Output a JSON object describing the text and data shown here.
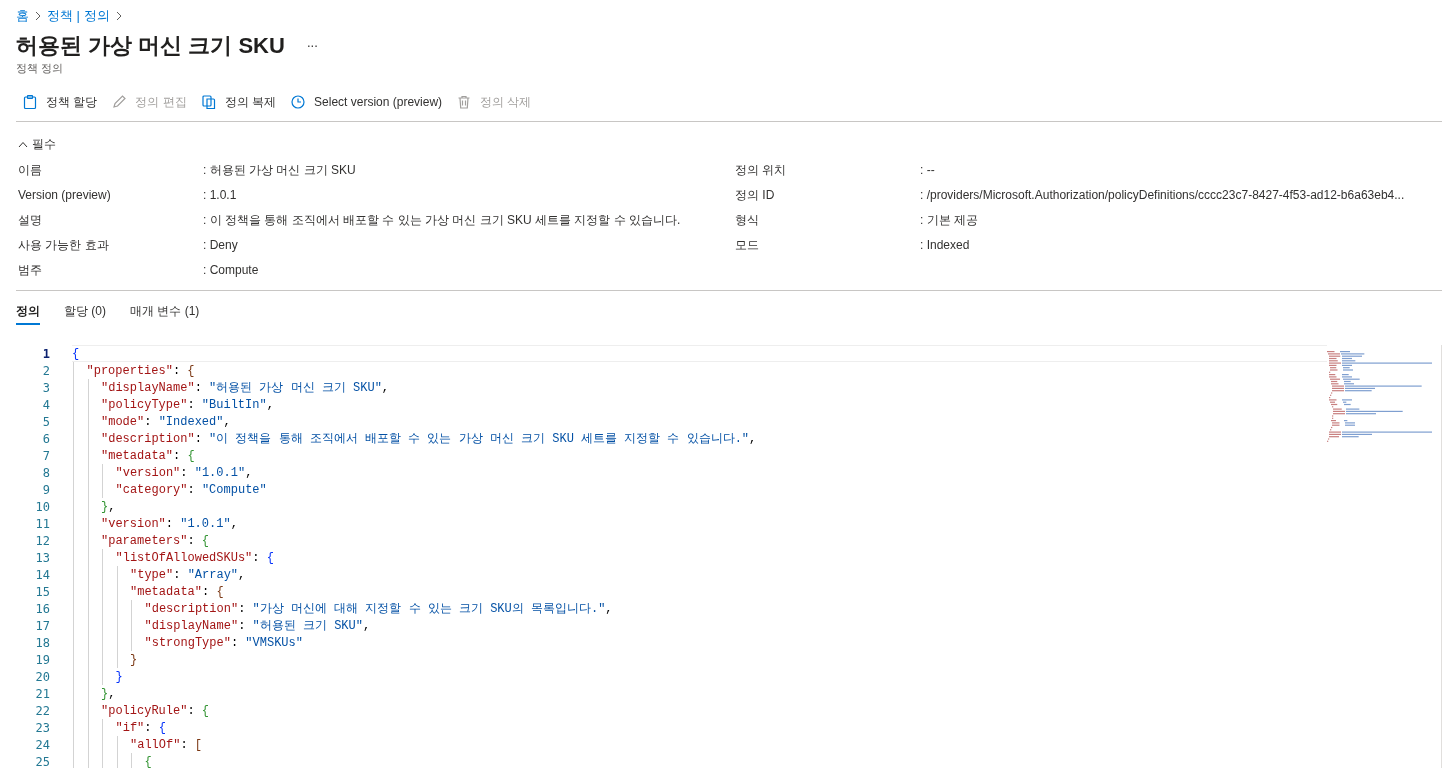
{
  "breadcrumb": [
    {
      "label": "홈"
    },
    {
      "label": "정책 | 정의"
    }
  ],
  "title": "허용된 가상 머신 크기 SKU",
  "more": "...",
  "subtitle": "정책 정의",
  "toolbar": [
    {
      "label": "정책 할당",
      "disabled": false
    },
    {
      "label": "정의 편집",
      "disabled": true
    },
    {
      "label": "정의 복제",
      "disabled": false
    },
    {
      "label": "Select version (preview)",
      "disabled": false
    },
    {
      "label": "정의 삭제",
      "disabled": true
    }
  ],
  "section": {
    "label": "필수",
    "expanded": true
  },
  "details_left": [
    {
      "label": "이름",
      "value": ": 허용된 가상 머신 크기 SKU"
    },
    {
      "label": "Version (preview)",
      "value": ": 1.0.1"
    },
    {
      "label": "설명",
      "value": ": 이 정책을 통해 조직에서 배포할 수 있는 가상 머신 크기 SKU 세트를 지정할 수 있습니다."
    },
    {
      "label": "사용 가능한 효과",
      "value": ": Deny"
    },
    {
      "label": "범주",
      "value": ": Compute"
    }
  ],
  "details_right": [
    {
      "label": "정의 위치",
      "value": ": --"
    },
    {
      "label": "정의 ID",
      "value": ": /providers/Microsoft.Authorization/policyDefinitions/cccc23c7-8427-4f53-ad12-b6a63eb4..."
    },
    {
      "label": "형식",
      "value": ": 기본 제공"
    },
    {
      "label": "모드",
      "value": ": Indexed"
    }
  ],
  "tabs": [
    {
      "label": "정의",
      "selected": true
    },
    {
      "label": "할당 (0)",
      "selected": false
    },
    {
      "label": "매개 변수 (1)",
      "selected": false
    }
  ],
  "code": [
    {
      "number": "1",
      "current": true,
      "tokens": [
        {
          "kind": "open",
          "text": "{"
        }
      ]
    },
    {
      "number": "2",
      "current": false,
      "tokens": [
        {
          "kind": "key",
          "text": "\"properties\""
        },
        {
          "kind": "punct",
          "text": ": "
        },
        {
          "kind": "open",
          "text": "{"
        }
      ]
    },
    {
      "number": "3",
      "current": false,
      "tokens": [
        {
          "kind": "key",
          "text": "\"displayName\""
        },
        {
          "kind": "punct",
          "text": ": "
        },
        {
          "kind": "string",
          "text": "\"허용된 가상 머신 크기 SKU\""
        },
        {
          "kind": "punct",
          "text": ","
        }
      ]
    },
    {
      "number": "4",
      "current": false,
      "tokens": [
        {
          "kind": "key",
          "text": "\"policyType\""
        },
        {
          "kind": "punct",
          "text": ": "
        },
        {
          "kind": "string",
          "text": "\"BuiltIn\""
        },
        {
          "kind": "punct",
          "text": ","
        }
      ]
    },
    {
      "number": "5",
      "current": false,
      "tokens": [
        {
          "kind": "key",
          "text": "\"mode\""
        },
        {
          "kind": "punct",
          "text": ": "
        },
        {
          "kind": "string",
          "text": "\"Indexed\""
        },
        {
          "kind": "punct",
          "text": ","
        }
      ]
    },
    {
      "number": "6",
      "current": false,
      "tokens": [
        {
          "kind": "key",
          "text": "\"description\""
        },
        {
          "kind": "punct",
          "text": ": "
        },
        {
          "kind": "string",
          "text": "\"이 정책을 통해 조직에서 배포할 수 있는 가상 머신 크기 SKU 세트를 지정할 수 있습니다.\""
        },
        {
          "kind": "punct",
          "text": ","
        }
      ]
    },
    {
      "number": "7",
      "current": false,
      "tokens": [
        {
          "kind": "key",
          "text": "\"metadata\""
        },
        {
          "kind": "punct",
          "text": ": "
        },
        {
          "kind": "open",
          "text": "{"
        }
      ]
    },
    {
      "number": "8",
      "current": false,
      "tokens": [
        {
          "kind": "key",
          "text": "\"version\""
        },
        {
          "kind": "punct",
          "text": ": "
        },
        {
          "kind": "string",
          "text": "\"1.0.1\""
        },
        {
          "kind": "punct",
          "text": ","
        }
      ]
    },
    {
      "number": "9",
      "current": false,
      "tokens": [
        {
          "kind": "key",
          "text": "\"category\""
        },
        {
          "kind": "punct",
          "text": ": "
        },
        {
          "kind": "string",
          "text": "\"Compute\""
        }
      ]
    },
    {
      "number": "10",
      "current": false,
      "tokens": [
        {
          "kind": "close",
          "text": "}"
        },
        {
          "kind": "punct",
          "text": ","
        }
      ]
    },
    {
      "number": "11",
      "current": false,
      "tokens": [
        {
          "kind": "key",
          "text": "\"version\""
        },
        {
          "kind": "punct",
          "text": ": "
        },
        {
          "kind": "string",
          "text": "\"1.0.1\""
        },
        {
          "kind": "punct",
          "text": ","
        }
      ]
    },
    {
      "number": "12",
      "current": false,
      "tokens": [
        {
          "kind": "key",
          "text": "\"parameters\""
        },
        {
          "kind": "punct",
          "text": ": "
        },
        {
          "kind": "open",
          "text": "{"
        }
      ]
    },
    {
      "number": "13",
      "current": false,
      "tokens": [
        {
          "kind": "key",
          "text": "\"listOfAllowedSKUs\""
        },
        {
          "kind": "punct",
          "text": ": "
        },
        {
          "kind": "open",
          "text": "{"
        }
      ]
    },
    {
      "number": "14",
      "current": false,
      "tokens": [
        {
          "kind": "key",
          "text": "\"type\""
        },
        {
          "kind": "punct",
          "text": ": "
        },
        {
          "kind": "string",
          "text": "\"Array\""
        },
        {
          "kind": "punct",
          "text": ","
        }
      ]
    },
    {
      "number": "15",
      "current": false,
      "tokens": [
        {
          "kind": "key",
          "text": "\"metadata\""
        },
        {
          "kind": "punct",
          "text": ": "
        },
        {
          "kind": "open",
          "text": "{"
        }
      ]
    },
    {
      "number": "16",
      "current": false,
      "tokens": [
        {
          "kind": "key",
          "text": "\"description\""
        },
        {
          "kind": "punct",
          "text": ": "
        },
        {
          "kind": "string",
          "text": "\"가상 머신에 대해 지정할 수 있는 크기 SKU의 목록입니다.\""
        },
        {
          "kind": "punct",
          "text": ","
        }
      ]
    },
    {
      "number": "17",
      "current": false,
      "tokens": [
        {
          "kind": "key",
          "text": "\"displayName\""
        },
        {
          "kind": "punct",
          "text": ": "
        },
        {
          "kind": "string",
          "text": "\"허용된 크기 SKU\""
        },
        {
          "kind": "punct",
          "text": ","
        }
      ]
    },
    {
      "number": "18",
      "current": false,
      "tokens": [
        {
          "kind": "key",
          "text": "\"strongType\""
        },
        {
          "kind": "punct",
          "text": ": "
        },
        {
          "kind": "string",
          "text": "\"VMSKUs\""
        }
      ]
    },
    {
      "number": "19",
      "current": false,
      "tokens": [
        {
          "kind": "close",
          "text": "}"
        }
      ]
    },
    {
      "number": "20",
      "current": false,
      "tokens": [
        {
          "kind": "close",
          "text": "}"
        }
      ]
    },
    {
      "number": "21",
      "current": false,
      "tokens": [
        {
          "kind": "close",
          "text": "}"
        },
        {
          "kind": "punct",
          "text": ","
        }
      ]
    },
    {
      "number": "22",
      "current": false,
      "tokens": [
        {
          "kind": "key",
          "text": "\"policyRule\""
        },
        {
          "kind": "punct",
          "text": ": "
        },
        {
          "kind": "open",
          "text": "{"
        }
      ]
    },
    {
      "number": "23",
      "current": false,
      "tokens": [
        {
          "kind": "key",
          "text": "\"if\""
        },
        {
          "kind": "punct",
          "text": ": "
        },
        {
          "kind": "open",
          "text": "{"
        }
      ]
    },
    {
      "number": "24",
      "current": false,
      "tokens": [
        {
          "kind": "key",
          "text": "\"allOf\""
        },
        {
          "kind": "punct",
          "text": ": "
        },
        {
          "kind": "open",
          "text": "["
        }
      ]
    },
    {
      "number": "25",
      "current": false,
      "tokens": [
        {
          "kind": "open",
          "text": "{"
        }
      ]
    }
  ]
}
